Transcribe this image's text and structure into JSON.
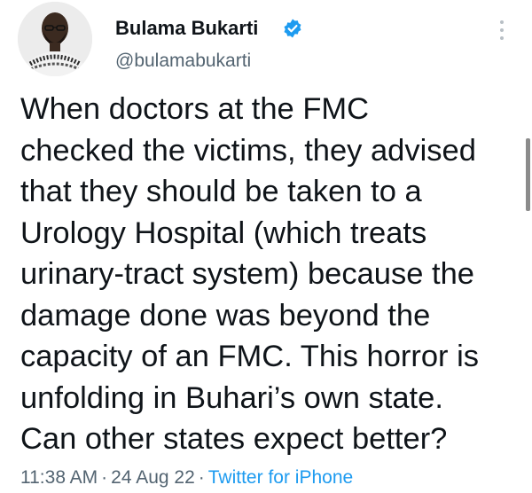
{
  "author": {
    "name": "Bulama Bukarti",
    "handle": "@bulamabukarti",
    "verified": true,
    "avatar_icon": "profile-photo"
  },
  "tweet": {
    "lines": [
      "When doctors at the FMC",
      "checked the victims, they advised",
      "that they should be taken to a",
      "Urology Hospital (which treats",
      "urinary-tract system) because the",
      "damage done was beyond the",
      "capacity of an FMC. This horror is",
      "unfolding in Buhari’s own state.",
      "Can other states expect better?"
    ]
  },
  "meta": {
    "time": "11:38 AM",
    "separator": "·",
    "date": "24 Aug 22",
    "source": "Twitter for iPhone"
  },
  "colors": {
    "text": "#0f1419",
    "secondary": "#536471",
    "accent": "#1d9bf0"
  },
  "icons": {
    "verified": "verified-badge-icon",
    "more": "more-options-icon"
  }
}
